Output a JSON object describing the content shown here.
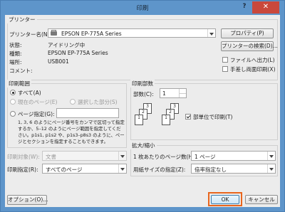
{
  "window": {
    "title": "印刷",
    "help": "?",
    "close": "✕"
  },
  "printer": {
    "group_title": "プリンター",
    "name_label": "プリンター名(N):",
    "name_value": "EPSON EP-775A Series",
    "properties_button": "プロパティ(P)",
    "find_button": "プリンターの検索(D)...",
    "status_label": "状態:",
    "status_value": "アイドリング中",
    "type_label": "種類:",
    "type_value": "EPSON EP-775A Series",
    "where_label": "場所:",
    "where_value": "USB001",
    "comment_label": "コメント:",
    "print_to_file": "ファイルへ出力(L)",
    "manual_duplex": "手差し両面印刷(X)"
  },
  "range": {
    "group_title": "印刷範囲",
    "all": "すべて(A)",
    "current_page": "現在のページ(E)",
    "selection": "選択した部分(S)",
    "pages": "ページ指定(G):",
    "pages_value": "",
    "help_text": "1, 3, 6 のようにページ番号をカンマで区切って指定するか、5–12 のようにページ範囲を指定してください。p1s1, p1s2 や、p1s3–p8s3 のように、ページとセクションを指定することもできます。"
  },
  "print_what": {
    "label": "印刷対象(W):",
    "value": "文書"
  },
  "print_spec": {
    "label": "印刷指定(R):",
    "value": "すべてのページ"
  },
  "copies": {
    "group_title": "印刷部数",
    "count_label": "部数(C):",
    "count_value": "1",
    "collate": "部単位で印刷(T)",
    "collate_checked": true,
    "sheets": [
      "1",
      "2",
      "3",
      "1",
      "2",
      "3"
    ]
  },
  "zoom": {
    "group_title": "拡大/縮小",
    "pages_per_sheet_label": "1 枚あたりのページ数(H):",
    "pages_per_sheet_value": "1 ページ",
    "scale_label": "用紙サイズの指定(Z):",
    "scale_value": "倍率指定なし"
  },
  "buttons": {
    "options": "オプション(O)...",
    "ok": "OK",
    "cancel": "キャンセル"
  },
  "colors": {
    "accent": "#e8651d",
    "title_bar": "#5e95ca",
    "close": "#c9483c"
  }
}
